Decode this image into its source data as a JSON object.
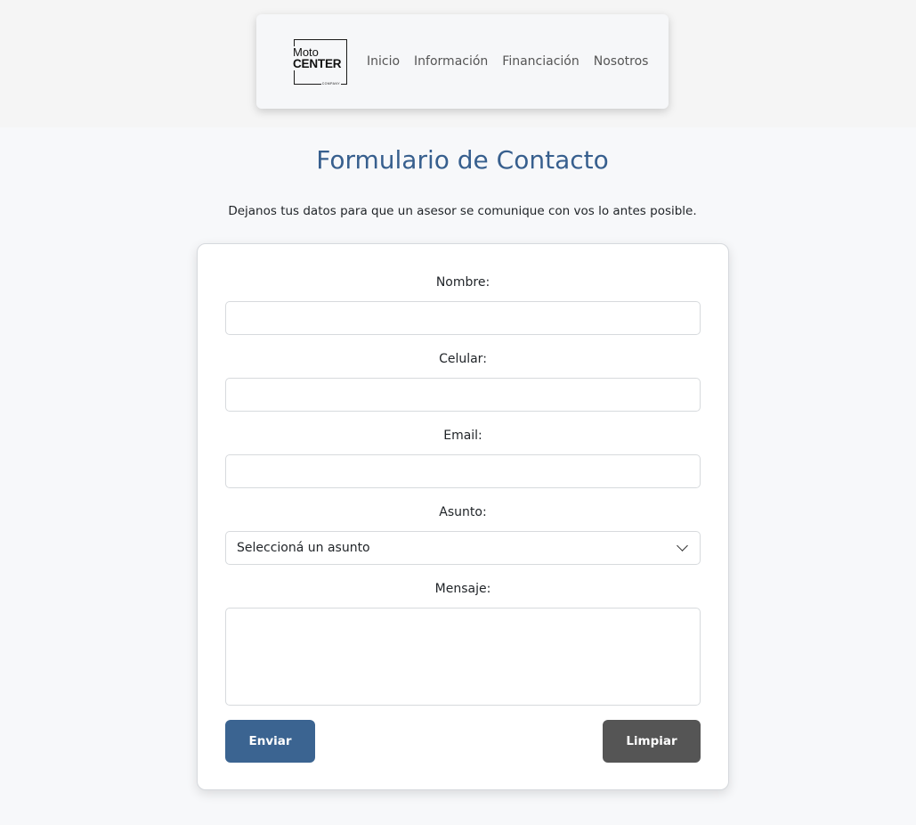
{
  "brand": {
    "logo_line1": "Moto",
    "logo_line2": "CENTER",
    "logo_line3": "COMPANY"
  },
  "nav": {
    "items": [
      {
        "label": "Inicio"
      },
      {
        "label": "Información"
      },
      {
        "label": "Financiación"
      },
      {
        "label": "Nosotros"
      }
    ]
  },
  "page": {
    "title": "Formulario de Contacto",
    "subtitle": "Dejanos tus datos para que un asesor se comunique con vos lo antes posible."
  },
  "form": {
    "name_label": "Nombre:",
    "name_value": "",
    "phone_label": "Celular:",
    "phone_value": "",
    "email_label": "Email:",
    "email_value": "",
    "subject_label": "Asunto:",
    "subject_selected": "Seleccioná un asunto",
    "message_label": "Mensaje:",
    "message_value": "",
    "send_label": "Enviar",
    "clear_label": "Limpiar"
  },
  "colors": {
    "title": "#375f8e",
    "send_button": "#3b6491",
    "clear_button": "#555555",
    "page_background": "#f7f8fa"
  }
}
